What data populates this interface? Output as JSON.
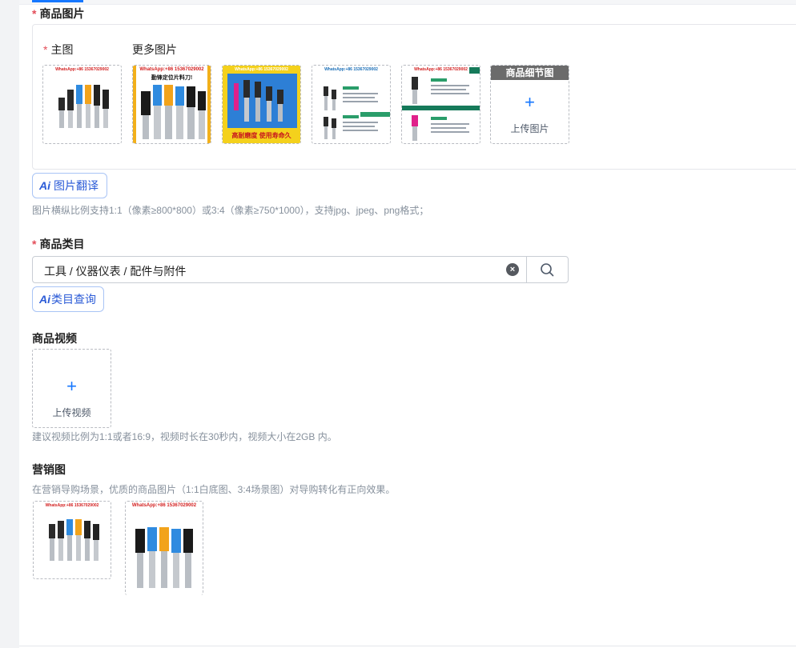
{
  "images_section": {
    "label": "商品图片",
    "main_label": "主图",
    "more_label": "更多图片",
    "thumbs": [
      {
        "name": "main-image-thumb",
        "watermark": "WhatsApp:+86 15367029002"
      },
      {
        "name": "more-image-thumb-1",
        "watermark": "WhatsApp:+86 15367029002",
        "caption": "勤锋定位片料刀!"
      },
      {
        "name": "more-image-thumb-2",
        "watermark": "WhatsApp:+86 15367029002",
        "caption": "高耐磨度 使用寿命久"
      },
      {
        "name": "more-image-thumb-3",
        "watermark": "WhatsApp:+86 15367029002"
      },
      {
        "name": "more-image-thumb-4",
        "watermark": "WhatsApp:+86 15367029002"
      }
    ],
    "detail_upload": {
      "header": "商品细节图",
      "text": "上传图片"
    },
    "ai_translate_label": "图片翻译",
    "hint": "图片横纵比例支持1:1（像素≥800*800）或3:4（像素≥750*1000），支持jpg、jpeg、png格式；"
  },
  "category_section": {
    "label": "商品类目",
    "value": "工具 / 仪器仪表 / 配件与附件",
    "ai_query_label": "类目查询"
  },
  "video_section": {
    "label": "商品视频",
    "upload_text": "上传视频",
    "hint": "建议视频比例为1:1或者16:9，视频时长在30秒内，视频大小在2GB 内。"
  },
  "marketing_section": {
    "label": "营销图",
    "hint": "在营销导购场景，优质的商品图片（1:1白底图、3:4场景图）对导购转化有正向效果。",
    "thumbs": [
      {
        "name": "marketing-image-square",
        "watermark": "WhatsApp:+86 15367029002"
      },
      {
        "name": "marketing-image-portrait",
        "watermark": "WhatsApp:+86 15367029002"
      }
    ]
  },
  "colors": {
    "accent": "#1677ff",
    "required": "#e34d59",
    "ai": "#2b5bd7"
  }
}
